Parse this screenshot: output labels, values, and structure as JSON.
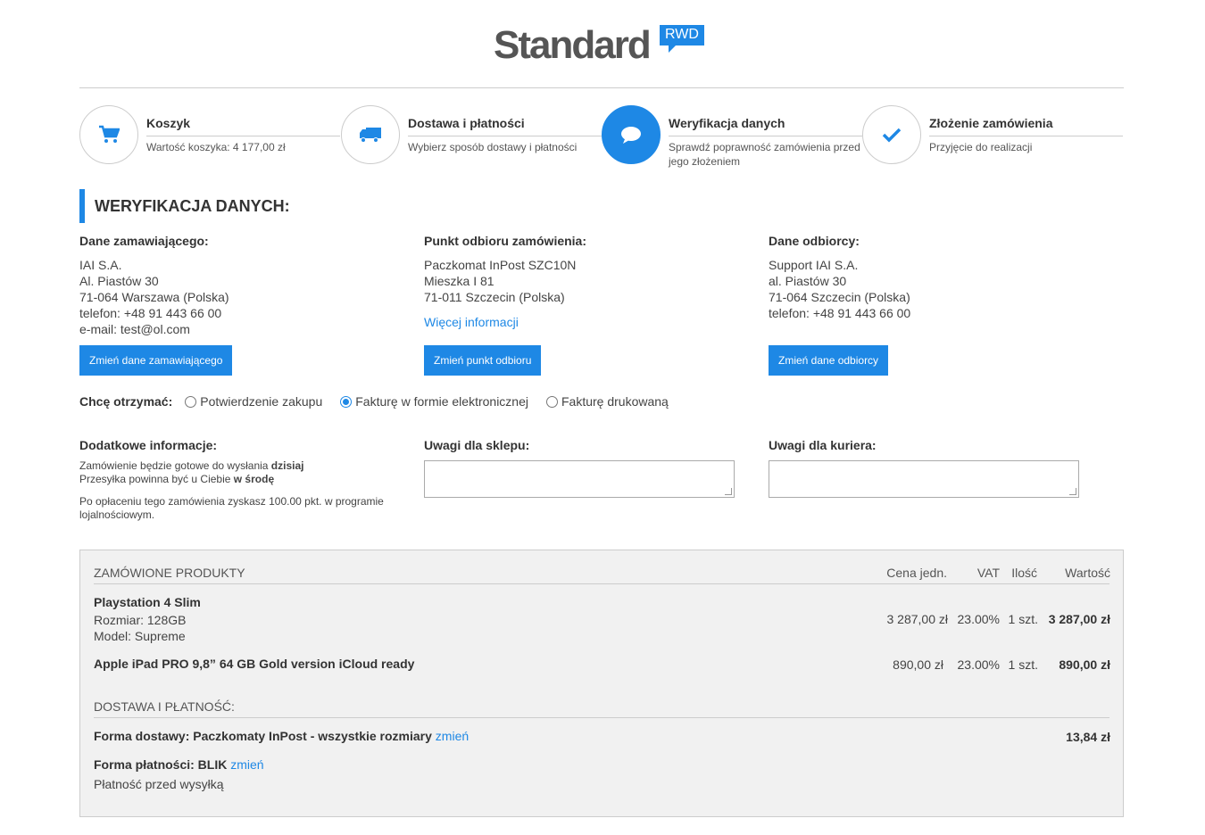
{
  "logo": {
    "text": "Standard",
    "badge": "RWD"
  },
  "steps": [
    {
      "title": "Koszyk",
      "desc": "Wartość koszyka: 4 177,00 zł",
      "icon": "cart-icon"
    },
    {
      "title": "Dostawa i płatności",
      "desc": "Wybierz sposób dostawy i płatności",
      "icon": "truck-icon"
    },
    {
      "title": "Weryfikacja danych",
      "desc": "Sprawdź poprawność zamówienia przed jego złożeniem",
      "icon": "chat-bubble-icon"
    },
    {
      "title": "Złożenie zamówienia",
      "desc": "Przyjęcie do realizacji",
      "icon": "checkmark-icon"
    }
  ],
  "section_title": "WERYFIKACJA DANYCH:",
  "orderer": {
    "title": "Dane zamawiającego:",
    "lines": [
      "IAI S.A.",
      "Al. Piastów 30",
      "71-064 Warszawa (Polska)",
      "telefon: +48 91 443 66 00",
      "e-mail: test@ol.com"
    ],
    "button": "Zmień dane zamawiającego"
  },
  "pickup": {
    "title": "Punkt odbioru zamówienia:",
    "lines": [
      "Paczkomat InPost SZC10N",
      "Mieszka I 81",
      "71-011 Szczecin (Polska)"
    ],
    "more": "Więcej informacji",
    "button": "Zmień punkt odbioru"
  },
  "recipient": {
    "title": "Dane odbiorcy:",
    "lines": [
      "Support IAI S.A.",
      "al. Piastów 30",
      "71-064 Szczecin (Polska)",
      "telefon: +48 91 443 66 00"
    ],
    "button": "Zmień dane odbiorcy"
  },
  "receive": {
    "label": "Chcę otrzymać:",
    "options": [
      "Potwierdzenie zakupu",
      "Fakturę w formie elektronicznej",
      "Fakturę drukowaną"
    ],
    "selected": "Fakturę w formie elektronicznej"
  },
  "additional": {
    "title": "Dodatkowe informacje:",
    "ready_prefix": "Zamówienie będzie gotowe do wysłania ",
    "ready_day": "dzisiaj",
    "arrive_prefix": "Przesyłka powinna być u Ciebie ",
    "arrive_day": "w środę",
    "points": "Po opłaceniu tego zamówienia zyskasz 100.00 pkt. w programie lojalnościowym."
  },
  "shop_notes": {
    "title": "Uwagi dla sklepu:",
    "value": ""
  },
  "courier_notes": {
    "title": "Uwagi dla kuriera:",
    "value": ""
  },
  "summary": {
    "products_header": "ZAMÓWIONE PRODUKTY",
    "columns": [
      "Cena jedn.",
      "VAT",
      "Ilość",
      "Wartość"
    ],
    "products": [
      {
        "name": "Playstation 4 Slim",
        "attrs": [
          "Rozmiar: 128GB",
          "Model: Supreme"
        ],
        "price": "3 287,00 zł",
        "vat": "23.00%",
        "qty": "1 szt.",
        "value": "3 287,00 zł"
      },
      {
        "name": "Apple iPad PRO 9,8” 64 GB Gold version iCloud ready",
        "attrs": [],
        "price": "890,00 zł",
        "vat": "23.00%",
        "qty": "1 szt.",
        "value": "890,00 zł"
      }
    ],
    "delivery_header": "DOSTAWA I PŁATNOŚĆ:",
    "delivery_label": "Forma dostawy: Paczkomaty InPost - wszystkie rozmiary",
    "delivery_change": "zmień",
    "delivery_cost": "13,84 zł",
    "payment_label": "Forma płatności: BLIK",
    "payment_change": "zmień",
    "payment_note": "Płatność przed wysyłką"
  }
}
